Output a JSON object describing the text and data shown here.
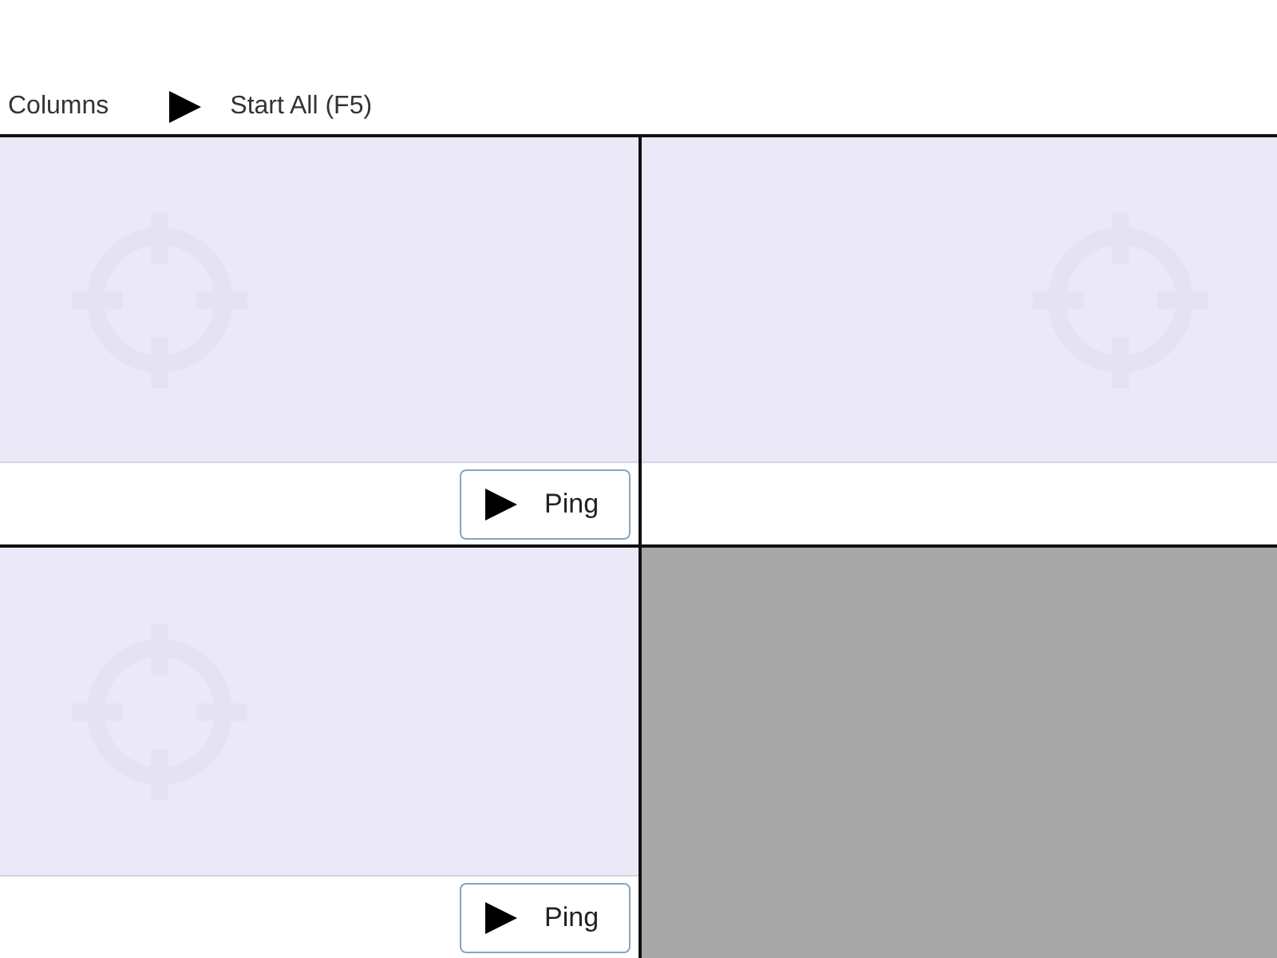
{
  "toolbar": [
    {
      "kind": "plain",
      "label": "Columns"
    },
    {
      "kind": "play",
      "label": "Start All (F5)"
    }
  ],
  "panes": [
    {
      "kind": "view",
      "button": {
        "kind": "play",
        "label": "Ping"
      }
    },
    {
      "kind": "view"
    },
    {
      "kind": "view",
      "button": {
        "kind": "play",
        "label": "Ping"
      }
    },
    {
      "kind": "empty"
    }
  ]
}
